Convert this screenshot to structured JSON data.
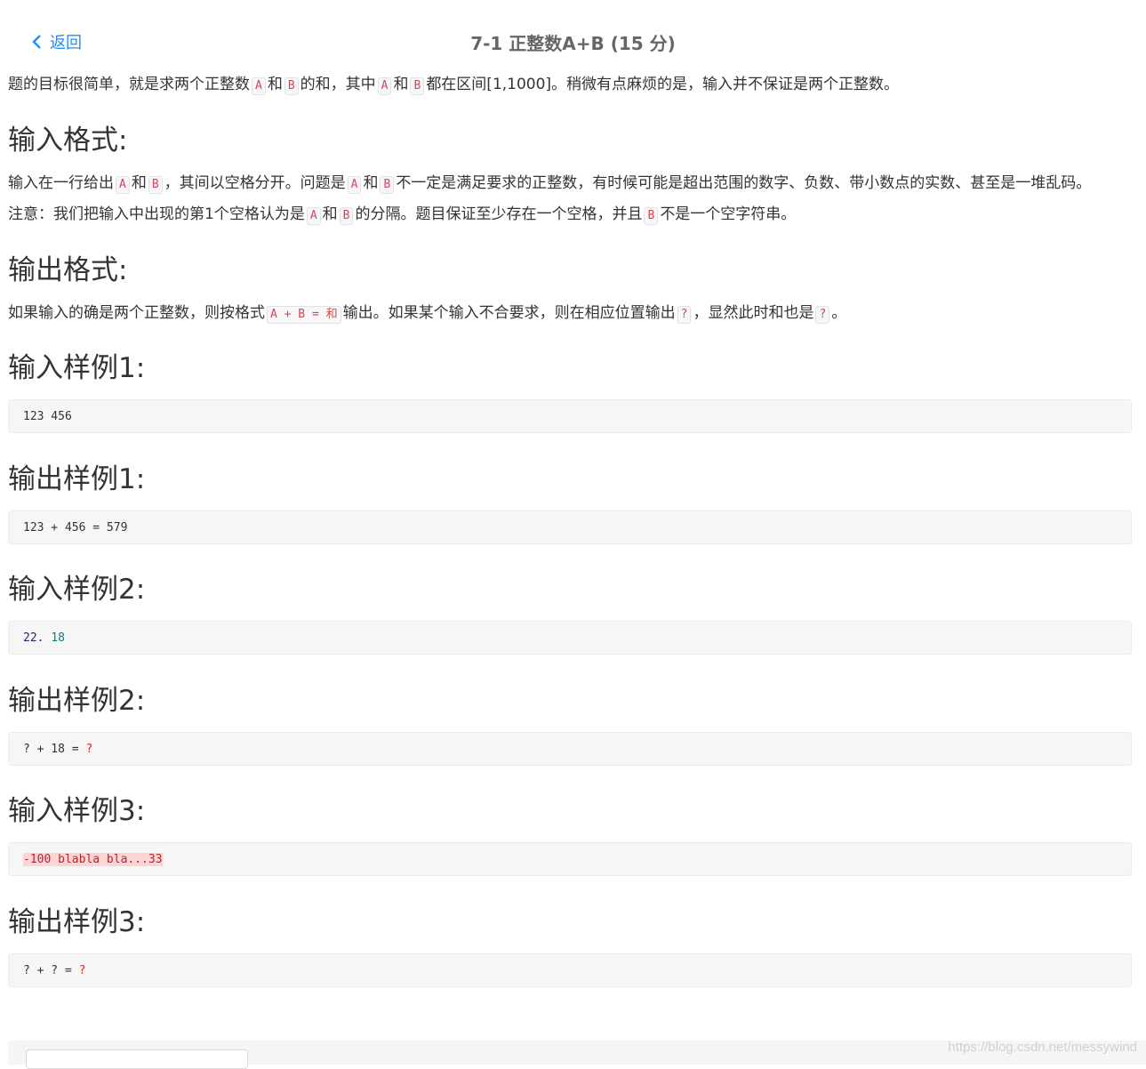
{
  "header": {
    "back_label": "返回",
    "title": "7-1 正整数A+B (15 分)"
  },
  "intro": {
    "t1": "题的目标很简单，就是求两个正整数",
    "a": "A",
    "he": "和",
    "b": "B",
    "t2": "的和，其中",
    "t3": "都在区间[1,1000]。稍微有点麻烦的是，输入并不保证是两个正整数。"
  },
  "input_format": {
    "heading": "输入格式:",
    "l1_t1": "输入在一行给出",
    "l1_t2": "，其间以空格分开。问题是",
    "l1_t3": "不一定是满足要求的正整数，有时候可能是超出范围的数字、负数、带小数点的实数、甚至是一堆乱码。",
    "l2_t1": "注意：我们把输入中出现的第1个空格认为是",
    "l2_t2": "的分隔。题目保证至少存在一个空格，并且",
    "l2_t3": "不是一个空字符串。"
  },
  "output_format": {
    "heading": "输出格式:",
    "t1": "如果输入的确是两个正整数，则按格式",
    "fmt": "A + B = 和",
    "t2": "输出。如果某个输入不合要求，则在相应位置输出",
    "q": "?",
    "t3": "，显然此时和也是",
    "t4": "。"
  },
  "samples": {
    "in1_heading": "输入样例1:",
    "in1": "123 456",
    "out1_heading": "输出样例1:",
    "out1": "123 + 456 = 579",
    "in2_heading": "输入样例2:",
    "in2_a": "22.",
    "in2_b": "18",
    "out2_heading": "输出样例2:",
    "out2_a": "? + 18 =",
    "out2_b": "?",
    "in3_heading": "输入样例3:",
    "in3": "-100 blabla bla...33",
    "out3_heading": "输出样例3:",
    "out3_a": "? + ? =",
    "out3_b": "?"
  },
  "watermark": "https://blog.csdn.net/messywind",
  "colors": {
    "link": "#1890ff",
    "code_text": "#d44950",
    "sample_bg": "#f6f6f6"
  }
}
